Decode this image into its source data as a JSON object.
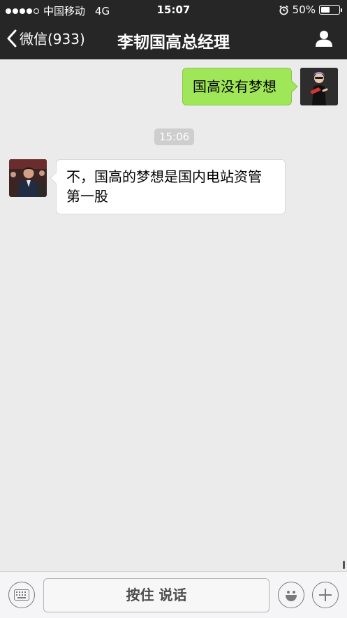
{
  "status_bar": {
    "carrier": "中国移动",
    "network": "4G",
    "time": "15:07",
    "battery_text": "50%",
    "battery_level": 0.5,
    "signal_bars_filled": 4,
    "signal_bars_total": 5
  },
  "nav": {
    "back_label": "微信(933)",
    "title": "李韧国高总经理"
  },
  "messages": [
    {
      "direction": "sent",
      "text": "国高没有梦想"
    },
    {
      "direction": "received",
      "text_line1": "不，国高的梦想是国内电站资管",
      "text_line2": "第一股"
    }
  ],
  "timestamp": "15:06",
  "input_bar": {
    "hold_to_talk_label": "按住 说话"
  },
  "colors": {
    "nav_bg": "#262626",
    "chat_bg": "#ebebeb",
    "sent_bubble": "#9fe658",
    "received_bubble": "#ffffff"
  }
}
